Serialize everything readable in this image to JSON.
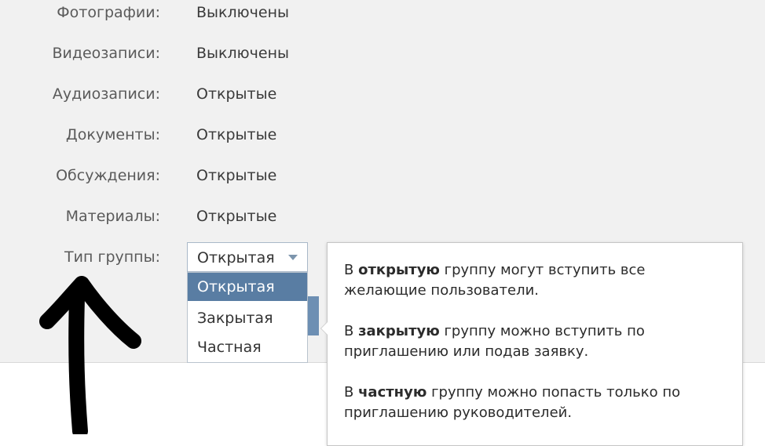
{
  "settings": {
    "rows": [
      {
        "label": "Фотографии:",
        "value": "Выключены"
      },
      {
        "label": "Видеозаписи:",
        "value": "Выключены"
      },
      {
        "label": "Аудиозаписи:",
        "value": "Открытые"
      },
      {
        "label": "Документы:",
        "value": "Открытые"
      },
      {
        "label": "Обсуждения:",
        "value": "Открытые"
      },
      {
        "label": "Материалы:",
        "value": "Открытые"
      }
    ],
    "group_type_label": "Тип группы:",
    "group_type_selected": "Открытая",
    "group_type_options": [
      "Открытая",
      "Закрытая",
      "Частная"
    ]
  },
  "tooltip": {
    "p1": {
      "pre": "В ",
      "bold": "открытую",
      "post": " группу могут вступить все желающие пользователи."
    },
    "p2": {
      "pre": "В ",
      "bold": "закрытую",
      "post": " группу можно вступить по приглашению или подав заявку."
    },
    "p3": {
      "pre": "В ",
      "bold": "частную",
      "post": " группу можно попасть только по приглашению руководителей."
    }
  },
  "colors": {
    "panel_bg": "#f1f1f1",
    "active_option": "#597da3",
    "annotation_arrow": "#000000"
  },
  "icons": {
    "select_caret": "chevron-down-icon",
    "annotation": "hand-drawn-arrow-up-icon"
  }
}
